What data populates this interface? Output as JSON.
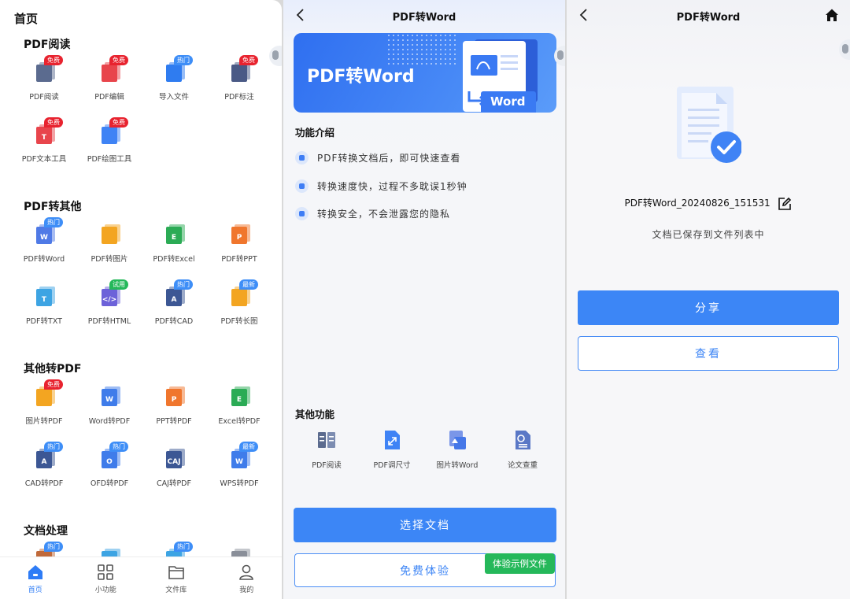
{
  "colors": {
    "primary": "#3c86f6",
    "badge_free": "#e8232f",
    "badge_hot": "#3e8ef7",
    "badge_trial": "#25b85a",
    "tag_green": "#25b85a"
  },
  "home": {
    "title": "首页",
    "sections": [
      {
        "title": "PDF阅读",
        "items": [
          {
            "label": "PDF阅读",
            "icon": "pdf-read-icon",
            "badge": "免费",
            "badge_type": "free"
          },
          {
            "label": "PDF编辑",
            "icon": "pdf-edit-icon",
            "badge": "免费",
            "badge_type": "free"
          },
          {
            "label": "导入文件",
            "icon": "import-file-icon",
            "badge": "热门",
            "badge_type": "hot"
          },
          {
            "label": "PDF标注",
            "icon": "pdf-annotate-icon",
            "badge": "免费",
            "badge_type": "free"
          },
          {
            "label": "PDF文本工具",
            "icon": "pdf-text-tool-icon",
            "badge": "免费",
            "badge_type": "free"
          },
          {
            "label": "PDF绘图工具",
            "icon": "pdf-draw-tool-icon",
            "badge": "免费",
            "badge_type": "free"
          }
        ]
      },
      {
        "title": "PDF转其他",
        "items": [
          {
            "label": "PDF转Word",
            "icon": "pdf-to-word-icon",
            "badge": "热门",
            "badge_type": "hot"
          },
          {
            "label": "PDF转图片",
            "icon": "pdf-to-image-icon",
            "badge": "",
            "badge_type": ""
          },
          {
            "label": "PDF转Excel",
            "icon": "pdf-to-excel-icon",
            "badge": "",
            "badge_type": ""
          },
          {
            "label": "PDF转PPT",
            "icon": "pdf-to-ppt-icon",
            "badge": "",
            "badge_type": ""
          },
          {
            "label": "PDF转TXT",
            "icon": "pdf-to-txt-icon",
            "badge": "",
            "badge_type": ""
          },
          {
            "label": "PDF转HTML",
            "icon": "pdf-to-html-icon",
            "badge": "试用",
            "badge_type": "trial"
          },
          {
            "label": "PDF转CAD",
            "icon": "pdf-to-cad-icon",
            "badge": "热门",
            "badge_type": "hot"
          },
          {
            "label": "PDF转长图",
            "icon": "pdf-to-long-image-icon",
            "badge": "最新",
            "badge_type": "hot"
          }
        ]
      },
      {
        "title": "其他转PDF",
        "items": [
          {
            "label": "图片转PDF",
            "icon": "image-to-pdf-icon",
            "badge": "免费",
            "badge_type": "free"
          },
          {
            "label": "Word转PDF",
            "icon": "word-to-pdf-icon",
            "badge": "",
            "badge_type": ""
          },
          {
            "label": "PPT转PDF",
            "icon": "ppt-to-pdf-icon",
            "badge": "",
            "badge_type": ""
          },
          {
            "label": "Excel转PDF",
            "icon": "excel-to-pdf-icon",
            "badge": "",
            "badge_type": ""
          },
          {
            "label": "CAD转PDF",
            "icon": "cad-to-pdf-icon",
            "badge": "热门",
            "badge_type": "hot"
          },
          {
            "label": "OFD转PDF",
            "icon": "ofd-to-pdf-icon",
            "badge": "热门",
            "badge_type": "hot"
          },
          {
            "label": "CAJ转PDF",
            "icon": "caj-to-pdf-icon",
            "badge": "",
            "badge_type": ""
          },
          {
            "label": "WPS转PDF",
            "icon": "wps-to-pdf-icon",
            "badge": "最新",
            "badge_type": "hot"
          }
        ]
      },
      {
        "title": "文档处理",
        "items": [
          {
            "label": "",
            "icon": "doc-process-1-icon",
            "badge": "热门",
            "badge_type": "hot"
          },
          {
            "label": "",
            "icon": "doc-process-2-icon",
            "badge": "",
            "badge_type": ""
          },
          {
            "label": "",
            "icon": "doc-process-3-icon",
            "badge": "热门",
            "badge_type": "hot"
          },
          {
            "label": "",
            "icon": "doc-process-4-icon",
            "badge": "",
            "badge_type": ""
          }
        ]
      }
    ],
    "nav": [
      {
        "label": "首页",
        "icon": "home-icon",
        "active": true
      },
      {
        "label": "小功能",
        "icon": "grid-icon",
        "active": false
      },
      {
        "label": "文件库",
        "icon": "folder-icon",
        "active": false
      },
      {
        "label": "我的",
        "icon": "user-icon",
        "active": false
      }
    ]
  },
  "convert": {
    "title": "PDF转Word",
    "banner_text": "PDF转Word",
    "banner_word": "Word",
    "intro_title": "功能介绍",
    "features": [
      "PDF转换文档后，即可快速查看",
      "转换速度快，过程不多耽误1秒钟",
      "转换安全，不会泄露您的隐私"
    ],
    "other_title": "其他功能",
    "others": [
      {
        "label": "PDF阅读",
        "icon": "pdf-read-icon"
      },
      {
        "label": "PDF调尺寸",
        "icon": "pdf-resize-icon"
      },
      {
        "label": "图片转Word",
        "icon": "image-to-word-icon"
      },
      {
        "label": "论文查重",
        "icon": "paper-check-icon"
      }
    ],
    "select_button": "选择文档",
    "free_button": "免费体验",
    "sample_tag": "体验示例文件"
  },
  "result": {
    "title": "PDF转Word",
    "file_name": "PDF转Word_20240826_151531",
    "saved_text": "文档已保存到文件列表中",
    "share_button": "分享",
    "view_button": "查看"
  }
}
